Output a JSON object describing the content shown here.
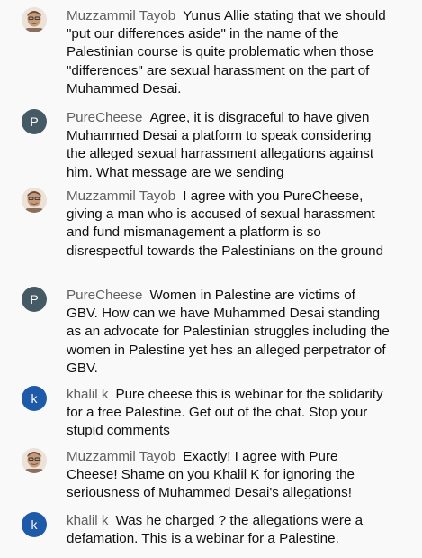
{
  "messages": [
    {
      "author": "Muzzammil Tayob",
      "avatar": {
        "type": "photo",
        "icon": "user-photo-icon"
      },
      "text": "Yunus Allie stating that we should \"put our differences aside\" in the name of the Palestinian course is quite problematic when those \"differences\" are sexual harassment on the part of Muhammed Desai."
    },
    {
      "author": "PureCheese",
      "avatar": {
        "type": "letter",
        "letter": "P",
        "color": "#455a64"
      },
      "text": "Agree, it is disgraceful to have given Muhammed Desai a platform to speak considering the alleged sexual harrassment allegations against him. What message are we sending"
    },
    {
      "author": "Muzzammil Tayob",
      "avatar": {
        "type": "photo",
        "icon": "user-photo-icon"
      },
      "text": "I agree with you PureCheese, giving a man who is accused of sexual harassment and fund mismanagement a platform is so disrespectful towards the Palestinians on the ground"
    },
    {
      "author": "PureCheese",
      "avatar": {
        "type": "letter",
        "letter": "P",
        "color": "#455a64"
      },
      "text": "Women in Palestine are victims of GBV. How can we have Muhammed Desai standing as an advocate for Palestinian struggles including the women in Palestine yet hes an alleged perpetrator of GBV."
    },
    {
      "author": "khalil k",
      "avatar": {
        "type": "letter",
        "letter": "k",
        "color": "#1e5aa8"
      },
      "text": "Pure cheese this is webinar for the solidarity for a free Palestine. Get out of the chat. Stop your stupid comments"
    },
    {
      "author": "Muzzammil Tayob",
      "avatar": {
        "type": "photo",
        "icon": "user-photo-icon"
      },
      "text": "Exactly! I agree with Pure Cheese! Shame on you Khalil K for ignoring the seriousness of Muhammed Desai's allegations!"
    },
    {
      "author": "khalil k",
      "avatar": {
        "type": "letter",
        "letter": "k",
        "color": "#1e5aa8"
      },
      "text": "Was he charged ? the allegations were a defamation. This is a webinar for a Palestine."
    }
  ]
}
